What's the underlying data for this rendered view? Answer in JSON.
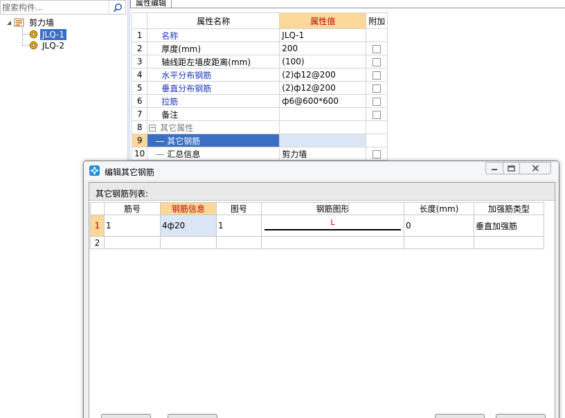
{
  "search": {
    "placeholder": "搜索构件..."
  },
  "tree": {
    "root_label": "剪力墙",
    "children": [
      {
        "label": "JLQ-1",
        "selected": true
      },
      {
        "label": "JLQ-2",
        "selected": false
      }
    ]
  },
  "property_panel": {
    "tab_label": "属性编辑",
    "headers": {
      "name": "属性名称",
      "value": "属性值",
      "extra": "附加"
    },
    "rows": [
      {
        "num": "1",
        "name": "名称",
        "value": "JLQ-1",
        "checkbox": false,
        "name_color": "blue"
      },
      {
        "num": "2",
        "name": "厚度(mm)",
        "value": "200",
        "checkbox": true,
        "name_color": "black"
      },
      {
        "num": "3",
        "name": "轴线距左墙皮距离(mm)",
        "value": "(100)",
        "checkbox": true,
        "name_color": "black"
      },
      {
        "num": "4",
        "name": "水平分布钢筋",
        "value": "(2)ф12@200",
        "checkbox": true,
        "name_color": "blue"
      },
      {
        "num": "5",
        "name": "垂直分布钢筋",
        "value": "(2)ф12@200",
        "checkbox": true,
        "name_color": "blue"
      },
      {
        "num": "6",
        "name": "拉筋",
        "value": "ф6@600*600",
        "checkbox": true,
        "name_color": "blue"
      },
      {
        "num": "7",
        "name": "备注",
        "value": "",
        "checkbox": true,
        "name_color": "black"
      },
      {
        "num": "8",
        "name": "其它属性",
        "value": "",
        "checkbox": false,
        "name_color": "gray"
      },
      {
        "num": "9",
        "name": "其它钢筋",
        "value": "",
        "checkbox": false,
        "name_color": "white"
      },
      {
        "num": "10",
        "name": "汇总信息",
        "value": "剪力墙",
        "checkbox": true,
        "name_color": "black"
      }
    ]
  },
  "dialog": {
    "title": "编辑其它钢筋",
    "list_label": "其它钢筋列表:",
    "columns": [
      "筋号",
      "钢筋信息",
      "图号",
      "钢筋图形",
      "长度(mm)",
      "加强筋类型"
    ],
    "rows": [
      {
        "num": "1",
        "bar_no": "1",
        "rebar_info": "4ф20",
        "figure_no": "1",
        "shape_label": "L",
        "length": "0",
        "type": "垂直加强筋"
      },
      {
        "num": "2",
        "bar_no": "",
        "rebar_info": "",
        "figure_no": "",
        "shape_label": "",
        "length": "",
        "type": ""
      }
    ]
  },
  "colors": {
    "accent": "#3a6fc4",
    "header_highlight": "#fbd898",
    "header_text_red": "#c00000",
    "link_blue": "#1a35b8"
  }
}
